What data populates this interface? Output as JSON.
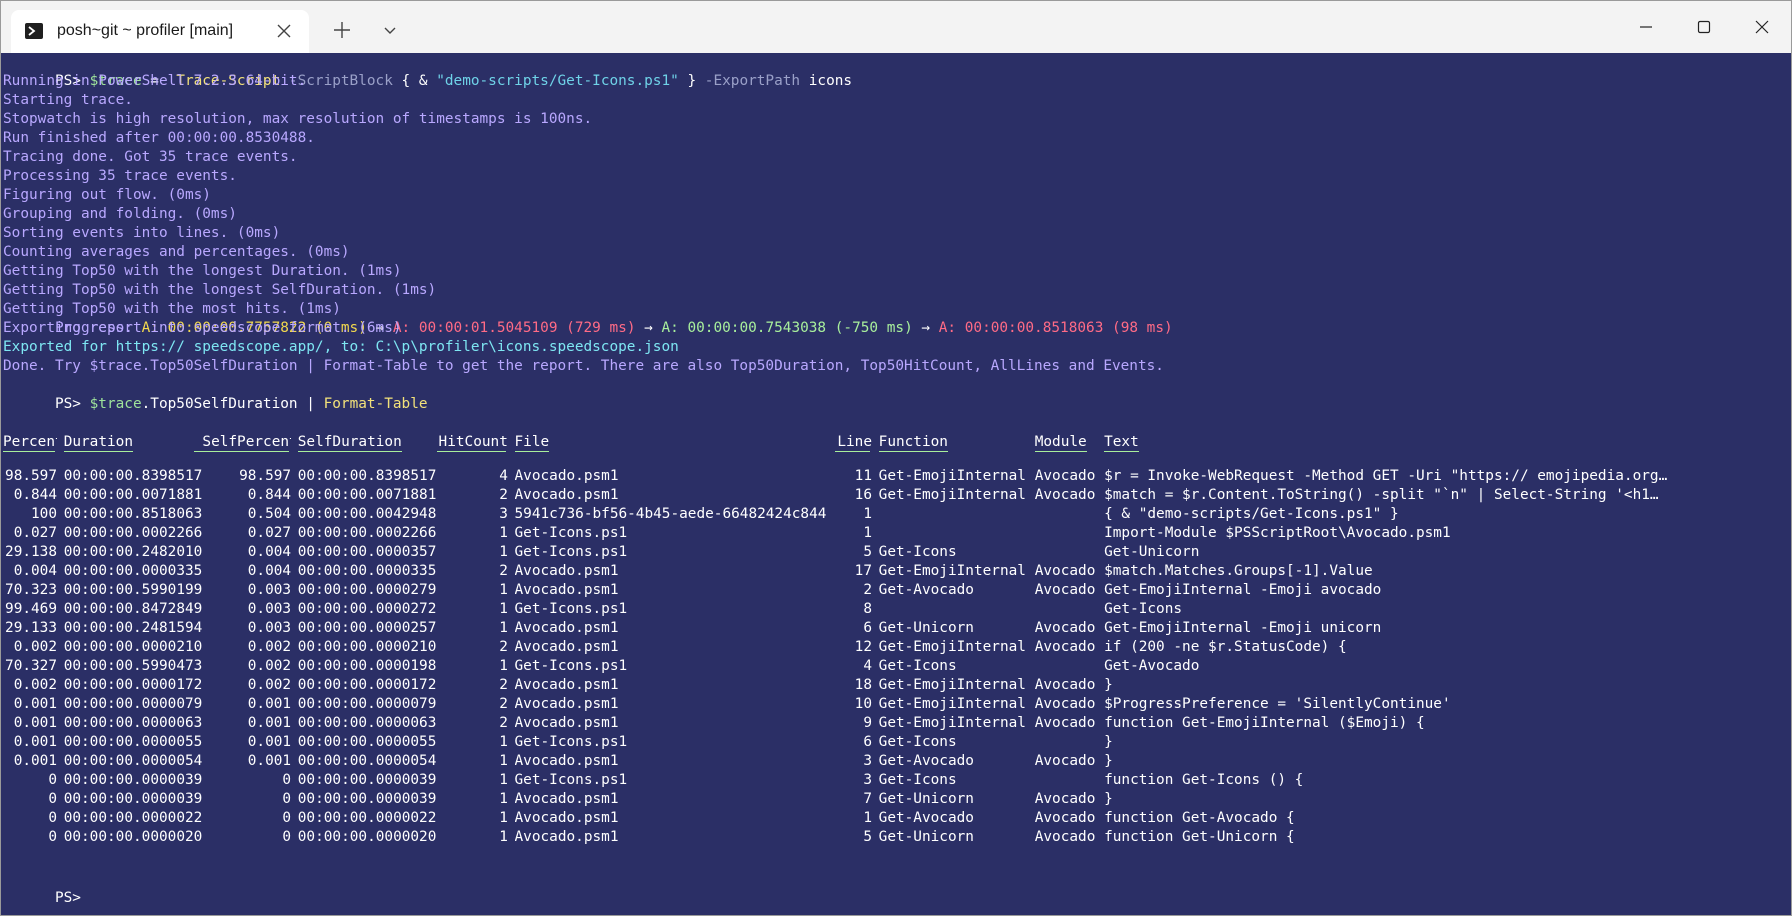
{
  "window": {
    "tab_title": "posh~git ~ profiler [main]",
    "icons": [
      "terminal-icon",
      "close-icon",
      "plus-icon",
      "chevron-down-icon",
      "minimize-icon",
      "maximize-icon",
      "window-close-icon"
    ]
  },
  "colors": {
    "background": "#2b2f66",
    "output": "#b9a8ff",
    "header": "#a8ef9c",
    "cmd": "#f2e17a",
    "string": "#6fd3e8",
    "progress_a": "#f2d94e",
    "progress_b": "#ff6b86",
    "progress_c": "#a8ef9c"
  },
  "cmd1": {
    "prompt": "PS> ",
    "var": "$trace",
    "eq": " =  ",
    "cmdlet": "Trace-Script",
    "p1": " -ScriptBlock ",
    "brace_open": "{ & ",
    "str": "\"demo-scripts/Get-Icons.ps1\"",
    "brace_close": " }",
    "p2": " -ExportPath ",
    "arg": "icons"
  },
  "output_lines": [
    "Running in PowerShell 7.2.3 64-bit.",
    "Starting trace.",
    "Stopwatch is high resolution, max resolution of timestamps is 100ns.",
    "Run finished after 00:00:00.8530488.",
    "Tracing done. Got 35 trace events.",
    "Processing 35 trace events.",
    "Figuring out flow. (0ms)",
    "Grouping and folding. (0ms)",
    "Sorting events into lines. (0ms)",
    "Counting averages and percentages. (0ms)",
    "Getting Top50 with the longest Duration. (1ms)",
    "Getting Top50 with the longest SelfDuration. (1ms)",
    "Getting Top50 with the most hits. (1ms)"
  ],
  "progress": {
    "label": "Progress: ",
    "s1": "A: 00:00:00.7757822 (0 ms)",
    "arrow1": " → ",
    "s2": "A: 00:00:01.5045109 (729 ms)",
    "arrow2": " → ",
    "s3": "A: 00:00:00.7543038 (-750 ms)",
    "arrow3": " → ",
    "s4": "A: 00:00:00.8518063 (98 ms)"
  },
  "export_line": "Exporting report into speedscope format. (6ms)",
  "exported_line": "Exported for https:// speedscope.app/, to: C:\\p\\profiler\\icons.speedscope.json",
  "done_line": "Done. Try $trace.Top50SelfDuration | Format-Table to get the report. There are also Top50Duration, Top50HitCount, AllLines and Events.",
  "cmd2": {
    "prompt": "PS> ",
    "var": "$trace",
    "member": ".Top50SelfDuration | ",
    "cmdlet": "Format-Table"
  },
  "table": {
    "headers": [
      "Percent",
      "Duration",
      "SelfPercent",
      "SelfDuration",
      "HitCount",
      "File",
      "Line",
      "Function",
      "Module",
      "Text"
    ],
    "rows": [
      [
        "98.597",
        "00:00:00.8398517",
        "98.597",
        "00:00:00.8398517",
        "4",
        "Avocado.psm1",
        "11",
        "Get-EmojiInternal",
        "Avocado",
        "$r = Invoke-WebRequest -Method GET -Uri \"https:// emojipedia.org…"
      ],
      [
        "0.844",
        "00:00:00.0071881",
        "0.844",
        "00:00:00.0071881",
        "2",
        "Avocado.psm1",
        "16",
        "Get-EmojiInternal",
        "Avocado",
        "$match = $r.Content.ToString() -split \"`n\" | Select-String '<h1…"
      ],
      [
        "100",
        "00:00:00.8518063",
        "0.504",
        "00:00:00.0042948",
        "3",
        "5941c736-bf56-4b45-aede-66482424c844",
        "1",
        "",
        "",
        "{ & \"demo-scripts/Get-Icons.ps1\" }"
      ],
      [
        "0.027",
        "00:00:00.0002266",
        "0.027",
        "00:00:00.0002266",
        "1",
        "Get-Icons.ps1",
        "1",
        "",
        "",
        "Import-Module $PSScriptRoot\\Avocado.psm1"
      ],
      [
        "29.138",
        "00:00:00.2482010",
        "0.004",
        "00:00:00.0000357",
        "1",
        "Get-Icons.ps1",
        "5",
        "Get-Icons",
        "",
        "Get-Unicorn"
      ],
      [
        "0.004",
        "00:00:00.0000335",
        "0.004",
        "00:00:00.0000335",
        "2",
        "Avocado.psm1",
        "17",
        "Get-EmojiInternal",
        "Avocado",
        "$match.Matches.Groups[-1].Value"
      ],
      [
        "70.323",
        "00:00:00.5990199",
        "0.003",
        "00:00:00.0000279",
        "1",
        "Avocado.psm1",
        "2",
        "Get-Avocado",
        "Avocado",
        "Get-EmojiInternal -Emoji avocado"
      ],
      [
        "99.469",
        "00:00:00.8472849",
        "0.003",
        "00:00:00.0000272",
        "1",
        "Get-Icons.ps1",
        "8",
        "",
        "",
        "Get-Icons"
      ],
      [
        "29.133",
        "00:00:00.2481594",
        "0.003",
        "00:00:00.0000257",
        "1",
        "Avocado.psm1",
        "6",
        "Get-Unicorn",
        "Avocado",
        "Get-EmojiInternal -Emoji unicorn"
      ],
      [
        "0.002",
        "00:00:00.0000210",
        "0.002",
        "00:00:00.0000210",
        "2",
        "Avocado.psm1",
        "12",
        "Get-EmojiInternal",
        "Avocado",
        "if (200 -ne $r.StatusCode) {"
      ],
      [
        "70.327",
        "00:00:00.5990473",
        "0.002",
        "00:00:00.0000198",
        "1",
        "Get-Icons.ps1",
        "4",
        "Get-Icons",
        "",
        "Get-Avocado"
      ],
      [
        "0.002",
        "00:00:00.0000172",
        "0.002",
        "00:00:00.0000172",
        "2",
        "Avocado.psm1",
        "18",
        "Get-EmojiInternal",
        "Avocado",
        "}"
      ],
      [
        "0.001",
        "00:00:00.0000079",
        "0.001",
        "00:00:00.0000079",
        "2",
        "Avocado.psm1",
        "10",
        "Get-EmojiInternal",
        "Avocado",
        "$ProgressPreference = 'SilentlyContinue'"
      ],
      [
        "0.001",
        "00:00:00.0000063",
        "0.001",
        "00:00:00.0000063",
        "2",
        "Avocado.psm1",
        "9",
        "Get-EmojiInternal",
        "Avocado",
        "function Get-EmojiInternal ($Emoji) {"
      ],
      [
        "0.001",
        "00:00:00.0000055",
        "0.001",
        "00:00:00.0000055",
        "1",
        "Get-Icons.ps1",
        "6",
        "Get-Icons",
        "",
        "}"
      ],
      [
        "0.001",
        "00:00:00.0000054",
        "0.001",
        "00:00:00.0000054",
        "1",
        "Avocado.psm1",
        "3",
        "Get-Avocado",
        "Avocado",
        "}"
      ],
      [
        "0",
        "00:00:00.0000039",
        "0",
        "00:00:00.0000039",
        "1",
        "Get-Icons.ps1",
        "3",
        "Get-Icons",
        "",
        "function Get-Icons () {"
      ],
      [
        "0",
        "00:00:00.0000039",
        "0",
        "00:00:00.0000039",
        "1",
        "Avocado.psm1",
        "7",
        "Get-Unicorn",
        "Avocado",
        "}"
      ],
      [
        "0",
        "00:00:00.0000022",
        "0",
        "00:00:00.0000022",
        "1",
        "Avocado.psm1",
        "1",
        "Get-Avocado",
        "Avocado",
        "function Get-Avocado {"
      ],
      [
        "0",
        "00:00:00.0000020",
        "0",
        "00:00:00.0000020",
        "1",
        "Avocado.psm1",
        "5",
        "Get-Unicorn",
        "Avocado",
        "function Get-Unicorn {"
      ]
    ]
  },
  "final_prompt": "PS> "
}
